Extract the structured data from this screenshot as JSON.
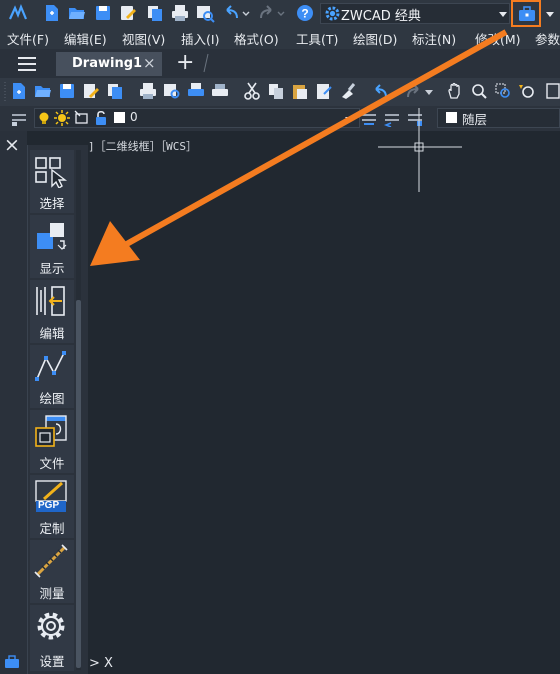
{
  "workspace": {
    "name": "ZWCAD 经典",
    "gear_icon": "gear-icon"
  },
  "menu": [
    "文件(F)",
    "编辑(E)",
    "视图(V)",
    "插入(I)",
    "格式(O)",
    "工具(T)",
    "绘图(D)",
    "标注(N)",
    "修改(M)",
    "参数"
  ],
  "tabs": {
    "active": "Drawing1",
    "close": "×",
    "add": "+"
  },
  "layer": {
    "name": "0",
    "linetype": "随层"
  },
  "viewport_info": "]［二维线框］［WCS］",
  "panel": {
    "close": "×",
    "items": [
      {
        "label": "选择",
        "icon": "select-icon"
      },
      {
        "label": "显示",
        "icon": "display-icon"
      },
      {
        "label": "编辑",
        "icon": "edit-icon"
      },
      {
        "label": "绘图",
        "icon": "draw-icon"
      },
      {
        "label": "文件",
        "icon": "file-icon"
      },
      {
        "label": "定制",
        "icon": "customize-icon",
        "badge": "PGP"
      },
      {
        "label": "测量",
        "icon": "measure-icon"
      },
      {
        "label": "设置",
        "icon": "settings-icon"
      }
    ]
  },
  "command_prompt": "> X",
  "colors": {
    "accent": "#f47c20",
    "background": "#212830",
    "highlight": "#1f66c9"
  }
}
